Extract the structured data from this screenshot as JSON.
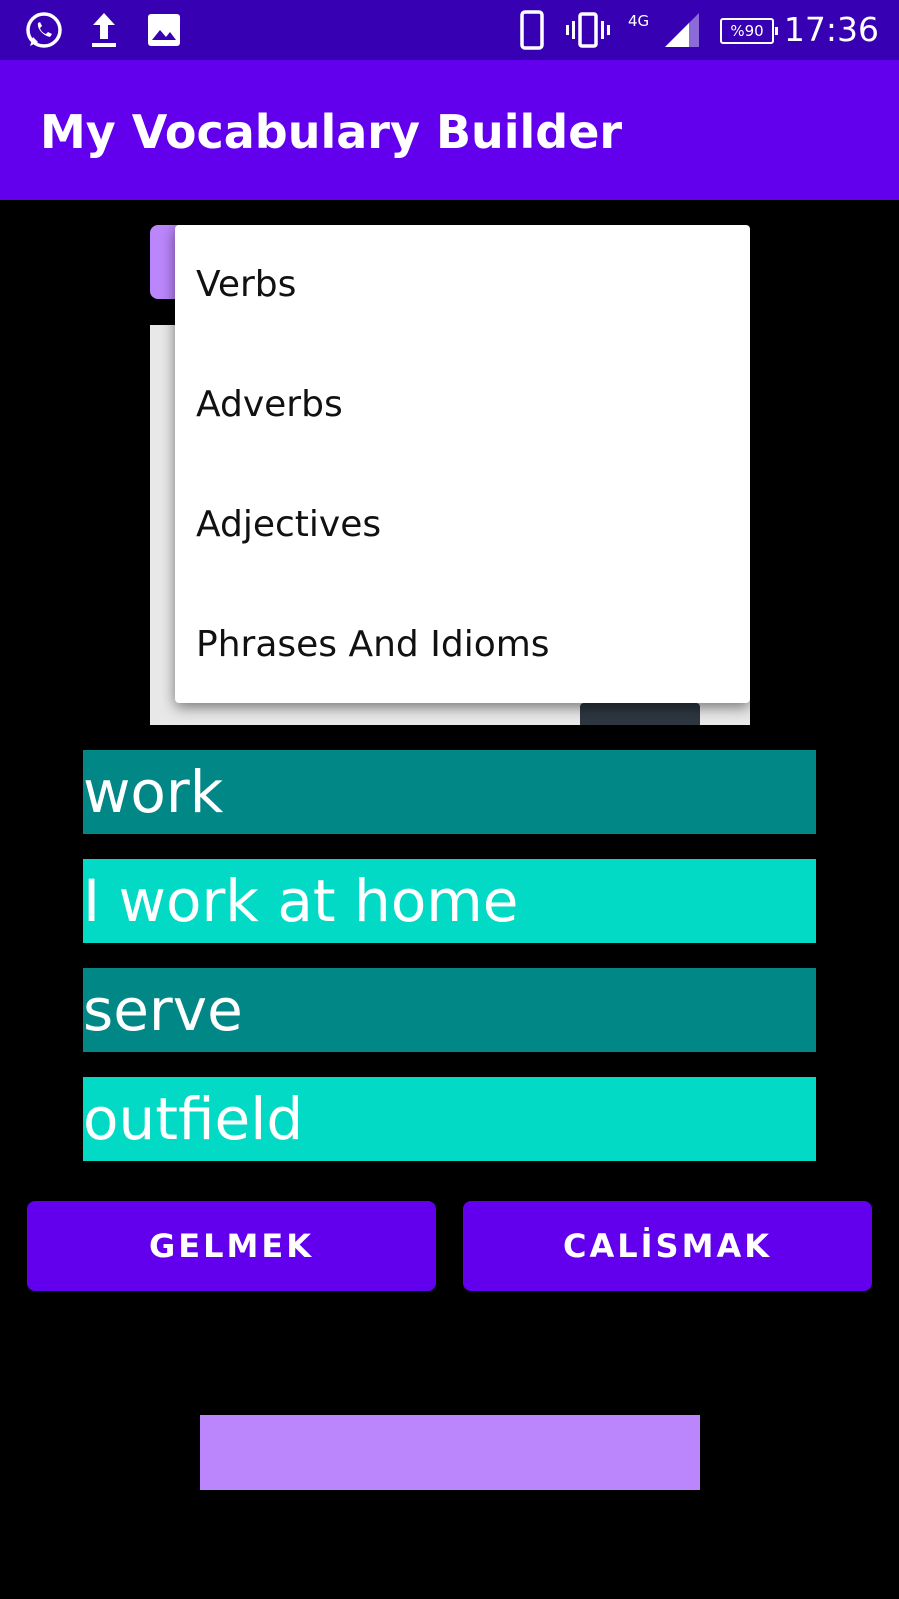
{
  "status_bar": {
    "time": "17:36",
    "network": "4G",
    "battery": "%90",
    "left_icons": [
      "whatsapp-icon",
      "upload-icon",
      "image-icon"
    ],
    "right_icons": [
      "phone-icon",
      "vibrate-icon",
      "signal-icon",
      "battery-icon"
    ]
  },
  "app_bar": {
    "title": "My Vocabulary Builder"
  },
  "category_menu": {
    "items": [
      {
        "label": "Verbs"
      },
      {
        "label": "Adverbs"
      },
      {
        "label": "Adjectives"
      },
      {
        "label": "Phrases And Idioms"
      }
    ]
  },
  "words": [
    {
      "text": "work"
    },
    {
      "text": "I work at home"
    },
    {
      "text": "serve"
    },
    {
      "text": "outfield"
    }
  ],
  "buttons": {
    "left_label": "GELMEK",
    "right_label": "CALİSMAK"
  },
  "colors": {
    "status_bar": "#3700b3",
    "app_bar": "#6200ee",
    "accent_light": "#bb86fc",
    "teal_dark": "#018786",
    "teal_light": "#03dac5"
  }
}
